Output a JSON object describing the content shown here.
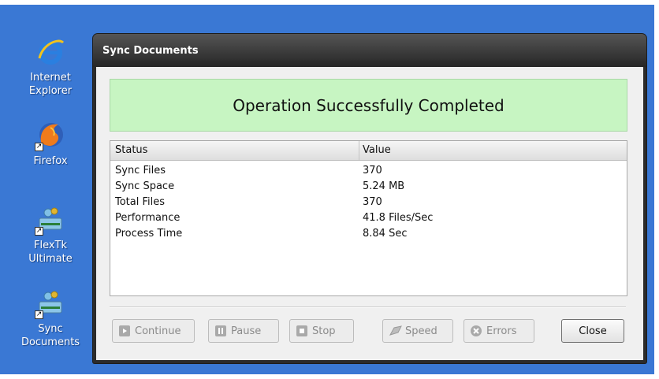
{
  "desktop": {
    "icons": [
      {
        "label_line1": "Internet",
        "label_line2": "Explorer",
        "icon": "internet-explorer-icon"
      },
      {
        "label_line1": "Firefox",
        "label_line2": "",
        "icon": "firefox-icon"
      },
      {
        "label_line1": "FlexTk",
        "label_line2": "Ultimate",
        "icon": "flextk-icon"
      },
      {
        "label_line1": "Sync",
        "label_line2": "Documents",
        "icon": "sync-documents-icon"
      }
    ]
  },
  "window": {
    "title": "Sync Documents",
    "banner": "Operation Successfully Completed",
    "table": {
      "headers": [
        "Status",
        "Value"
      ],
      "rows": [
        [
          "Sync Files",
          "370"
        ],
        [
          "Sync Space",
          "5.24 MB"
        ],
        [
          "Total Files",
          "370"
        ],
        [
          "Performance",
          "41.8 Files/Sec"
        ],
        [
          "Process Time",
          "8.84 Sec"
        ]
      ]
    },
    "buttons": {
      "continue": "Continue",
      "pause": "Pause",
      "stop": "Stop",
      "speed": "Speed",
      "errors": "Errors",
      "close": "Close"
    }
  },
  "colors": {
    "desktop": "#3a78d4",
    "banner": "#c7f5c2",
    "titlebar": "#2b2b2b"
  }
}
